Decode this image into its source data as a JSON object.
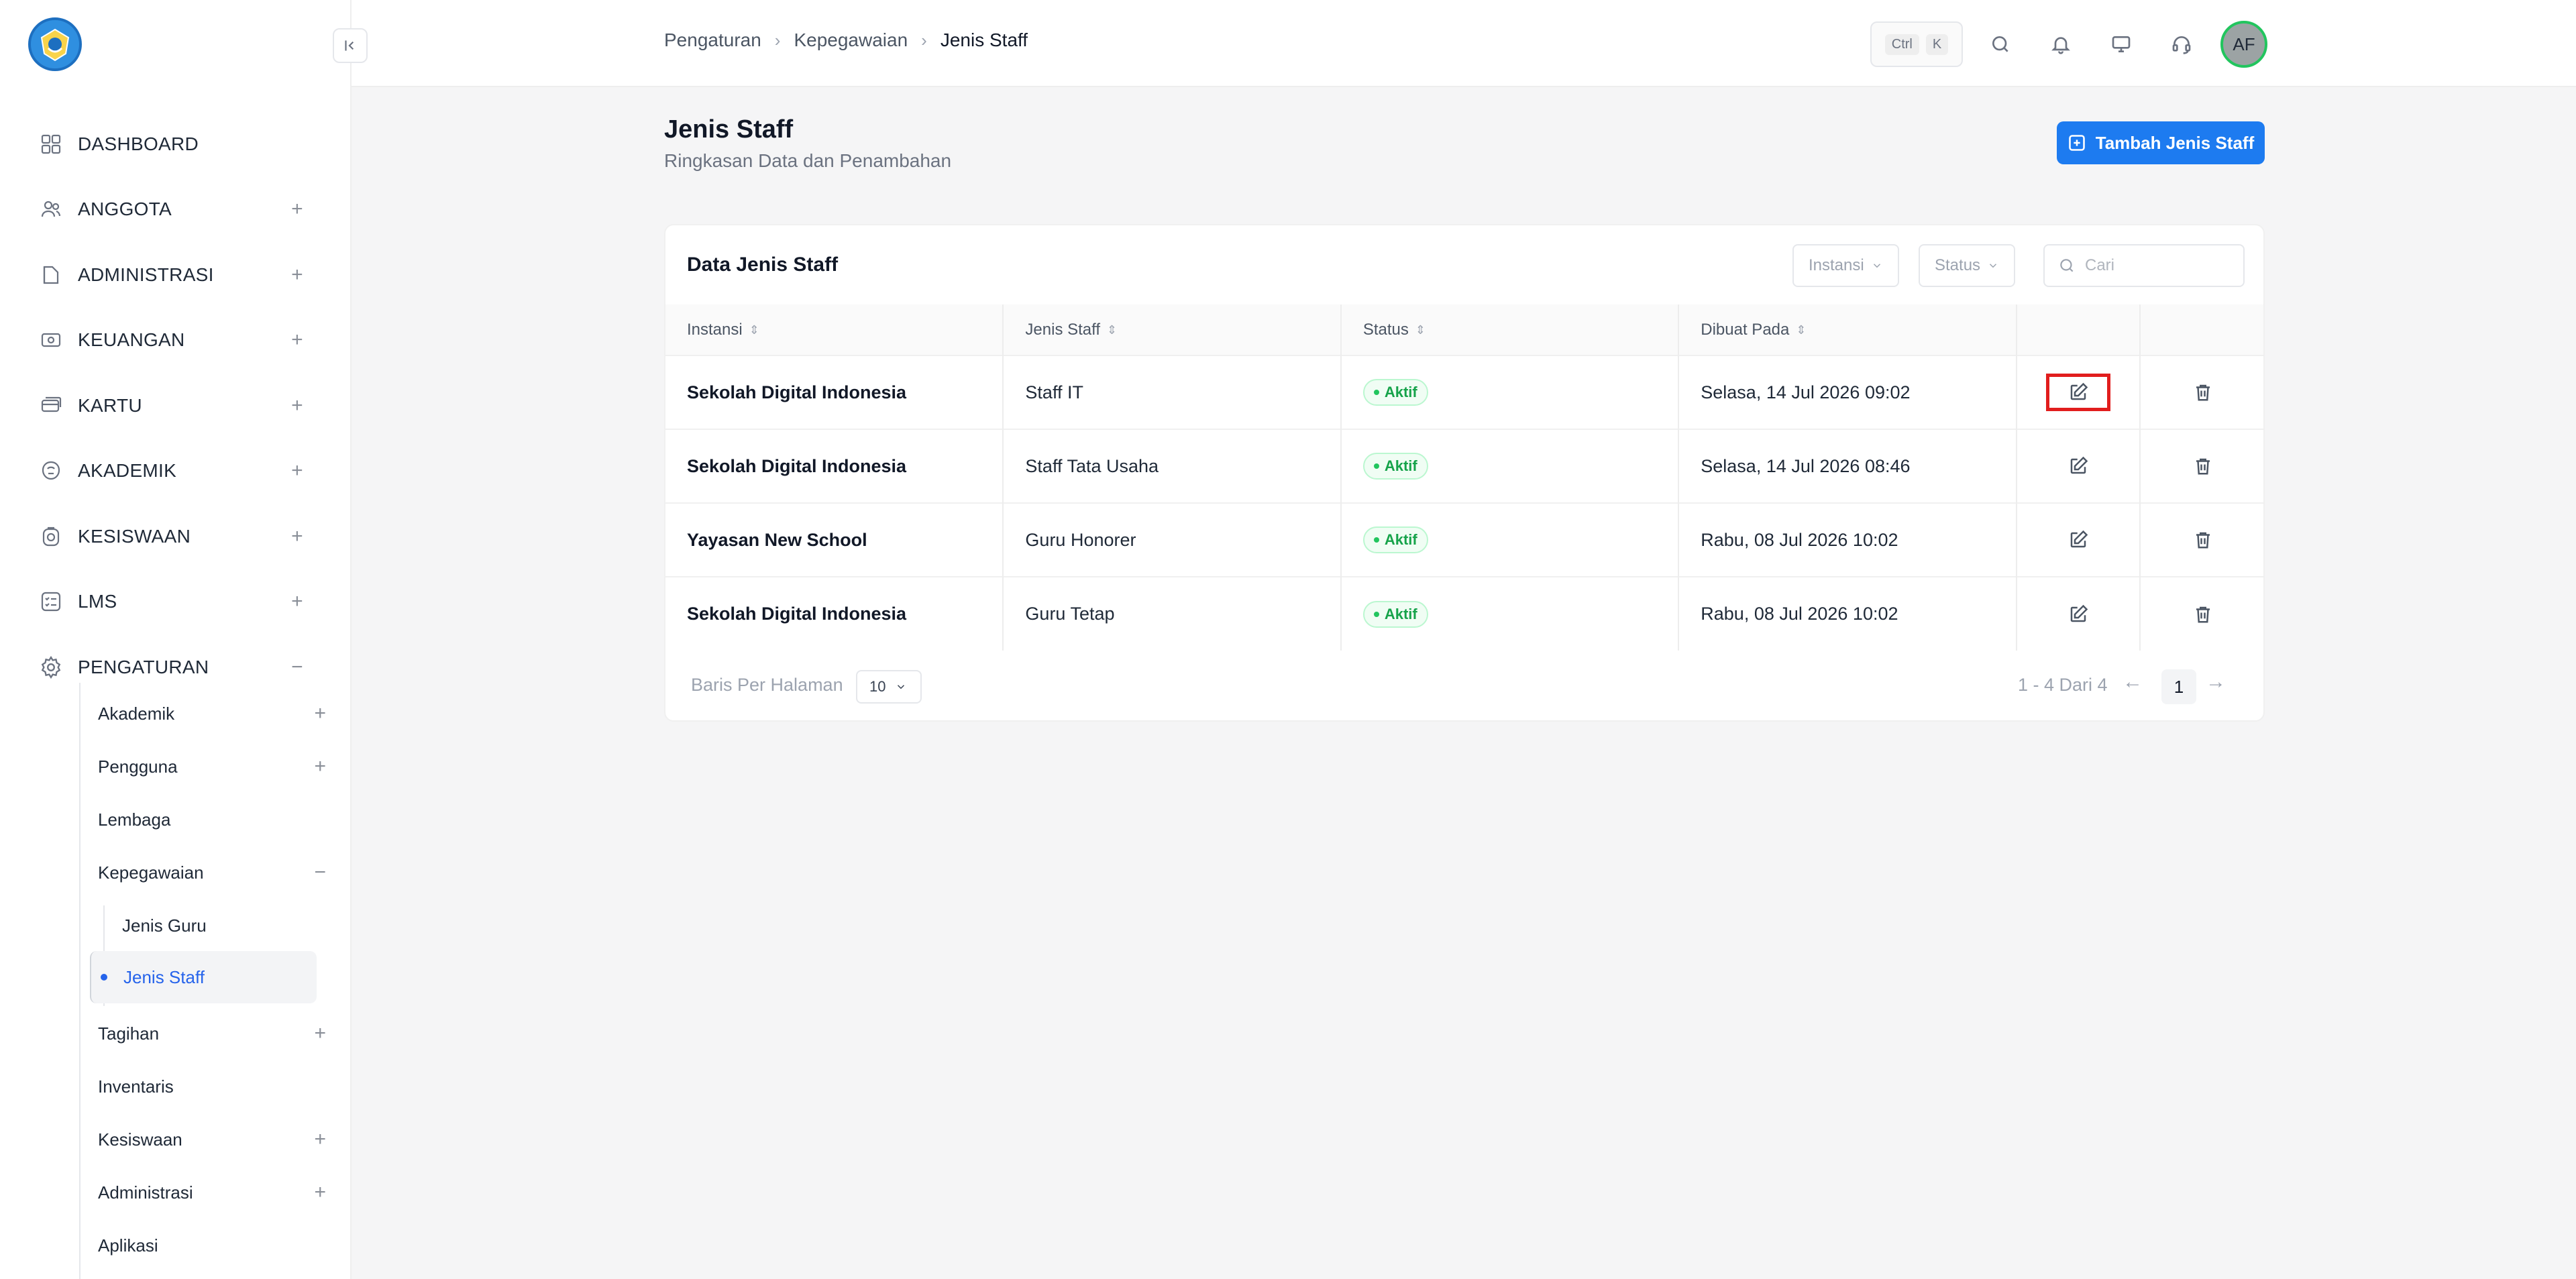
{
  "breadcrumb": [
    "Pengaturan",
    "Kepegawaian",
    "Jenis Staff"
  ],
  "shortcut": {
    "ctrl": "Ctrl",
    "key": "K"
  },
  "user": {
    "initials": "AF"
  },
  "sidebar": {
    "items": [
      {
        "label": "DASHBOARD",
        "icon": "dashboard-icon"
      },
      {
        "label": "ANGGOTA",
        "icon": "users-icon"
      },
      {
        "label": "ADMINISTRASI",
        "icon": "folder-icon"
      },
      {
        "label": "KEUANGAN",
        "icon": "money-icon"
      },
      {
        "label": "KARTU",
        "icon": "card-icon"
      },
      {
        "label": "AKADEMIK",
        "icon": "academic-icon"
      },
      {
        "label": "KESISWAAN",
        "icon": "student-icon"
      },
      {
        "label": "LMS",
        "icon": "checklist-icon"
      },
      {
        "label": "PENGATURAN",
        "icon": "gear-icon"
      }
    ],
    "sub": {
      "akademik": "Akademik",
      "pengguna": "Pengguna",
      "lembaga": "Lembaga",
      "kepegawaian": "Kepegawaian",
      "jenis_guru": "Jenis Guru",
      "jenis_staff": "Jenis Staff",
      "tagihan": "Tagihan",
      "inventaris": "Inventaris",
      "kesiswaan": "Kesiswaan",
      "administrasi": "Administrasi",
      "aplikasi": "Aplikasi"
    }
  },
  "page": {
    "title": "Jenis Staff",
    "subtitle": "Ringkasan Data dan Penambahan",
    "add_button": "Tambah Jenis Staff"
  },
  "card": {
    "title": "Data Jenis Staff",
    "filter_instansi": "Instansi",
    "filter_status": "Status",
    "search_placeholder": "Cari"
  },
  "table": {
    "headers": [
      "Instansi",
      "Jenis Staff",
      "Status",
      "Dibuat Pada"
    ],
    "rows": [
      {
        "instansi": "Sekolah Digital Indonesia",
        "jenis": "Staff IT",
        "status": "Aktif",
        "dibuat": "Selasa, 14 Jul 2026 09:02"
      },
      {
        "instansi": "Sekolah Digital Indonesia",
        "jenis": "Staff Tata Usaha",
        "status": "Aktif",
        "dibuat": "Selasa, 14 Jul 2026 08:46"
      },
      {
        "instansi": "Yayasan New School",
        "jenis": "Guru Honorer",
        "status": "Aktif",
        "dibuat": "Rabu, 08 Jul 2026 10:02"
      },
      {
        "instansi": "Sekolah Digital Indonesia",
        "jenis": "Guru Tetap",
        "status": "Aktif",
        "dibuat": "Rabu, 08 Jul 2026 10:02"
      }
    ]
  },
  "pagination": {
    "rows_label": "Baris Per Halaman",
    "rows_value": "10",
    "info": "1 - 4 Dari 4",
    "current_page": "1",
    "prev": "←",
    "next": "→"
  },
  "colors": {
    "primary": "#1d7bf0",
    "active": "#2563eb",
    "success": "#16a34a",
    "highlight": "#e11d1d"
  }
}
